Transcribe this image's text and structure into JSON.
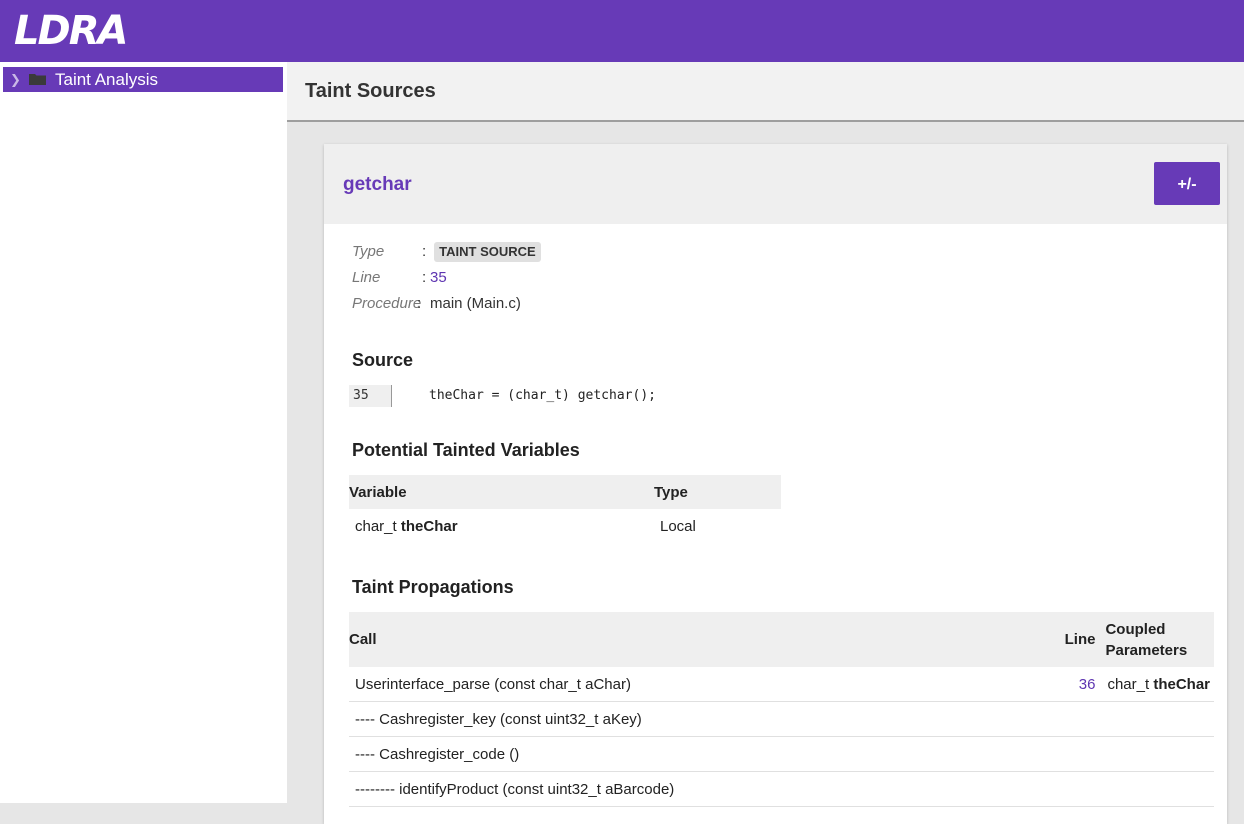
{
  "app": {
    "logo": "LDRA"
  },
  "sidebar": {
    "items": [
      {
        "label": "Taint Analysis"
      }
    ]
  },
  "header": {
    "title": "Taint Sources"
  },
  "card": {
    "title": "getchar",
    "toggle_label": "+/-",
    "props": {
      "type_key": "Type",
      "type_val": "TAINT SOURCE",
      "line_key": "Line",
      "line_val": "35",
      "proc_key": "Procedure",
      "proc_val": "main (Main.c)",
      "separator": ":"
    },
    "source": {
      "heading": "Source",
      "line_number": "35",
      "code": "theChar = (char_t) getchar();"
    },
    "variables": {
      "heading": "Potential Tainted Variables",
      "columns": [
        "Variable",
        "Type"
      ],
      "rows": [
        {
          "type_prefix": "char_t",
          "name": "theChar",
          "scope": "Local"
        }
      ]
    },
    "propagations": {
      "heading": "Taint Propagations",
      "columns": [
        "Call",
        "Line",
        "Coupled Parameters"
      ],
      "rows": [
        {
          "call": "Userinterface_parse (const char_t aChar)",
          "line": "36",
          "param_type": "char_t",
          "param_name": "theChar"
        },
        {
          "call": "---- Cashregister_key (const uint32_t aKey)",
          "line": "",
          "param_type": "",
          "param_name": ""
        },
        {
          "call": "---- Cashregister_code ()",
          "line": "",
          "param_type": "",
          "param_name": ""
        },
        {
          "call": "-------- identifyProduct (const uint32_t aBarcode)",
          "line": "",
          "param_type": "",
          "param_name": ""
        }
      ]
    }
  },
  "colors": {
    "accent": "#673ab7",
    "link": "#5e35b1",
    "panel": "#efefef"
  }
}
